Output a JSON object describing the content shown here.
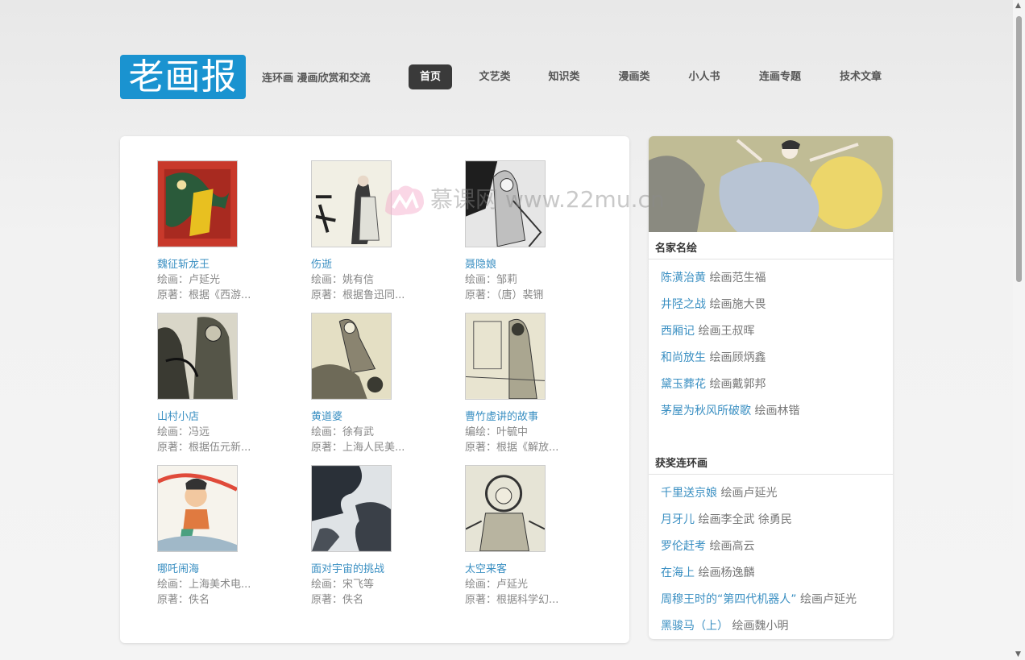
{
  "header": {
    "logo": "老画报",
    "tagline": "连环画 漫画欣赏和交流",
    "nav": [
      {
        "label": "首页",
        "active": true
      },
      {
        "label": "文艺类"
      },
      {
        "label": "知识类"
      },
      {
        "label": "漫画类"
      },
      {
        "label": "小人书"
      },
      {
        "label": "连画专题"
      },
      {
        "label": "技术文章"
      }
    ]
  },
  "books": [
    {
      "title": "魏征斩龙王",
      "line1": "绘画：卢延光",
      "line2": "原著：根据《西游..."
    },
    {
      "title": "伤逝",
      "line1": "绘画：姚有信",
      "line2": "原著：根据鲁迅同..."
    },
    {
      "title": "聂隐娘",
      "line1": "绘画：邹莉",
      "line2": "原著：（唐）裴铏"
    },
    {
      "title": "山村小店",
      "line1": "绘画：冯远",
      "line2": "原著：根据伍元新..."
    },
    {
      "title": "黄道婆",
      "line1": "绘画：徐有武",
      "line2": "原著：上海人民美..."
    },
    {
      "title": "曹竹虚讲的故事",
      "line1": "编绘：叶毓中",
      "line2": "原著：根据《解放..."
    },
    {
      "title": "哪吒闹海",
      "line1": "绘画：上海美术电...",
      "line2": "原著：佚名"
    },
    {
      "title": "面对宇宙的挑战",
      "line1": "绘画：宋飞等",
      "line2": "原著：佚名"
    },
    {
      "title": "太空来客",
      "line1": "绘画：卢延光",
      "line2": "原著：根据科学幻..."
    }
  ],
  "sidebar": {
    "section1": {
      "title": "名家名绘",
      "items": [
        {
          "link": "陈潢治黄",
          "note": "绘画范生福"
        },
        {
          "link": "井陉之战",
          "note": "绘画施大畏"
        },
        {
          "link": "西厢记",
          "note": "绘画王叔晖"
        },
        {
          "link": "和尚放生",
          "note": "绘画顾炳鑫"
        },
        {
          "link": "黛玉葬花",
          "note": "绘画戴郭邦"
        },
        {
          "link": "茅屋为秋风所破歌",
          "note": "绘画林锴"
        }
      ]
    },
    "section2": {
      "title": "获奖连环画",
      "items": [
        {
          "link": "千里送京娘",
          "note": "绘画卢延光"
        },
        {
          "link": "月牙儿",
          "note": "绘画李全武 徐勇民"
        },
        {
          "link": "罗伦赶考",
          "note": "绘画高云"
        },
        {
          "link": "在海上",
          "note": "绘画杨逸麟"
        },
        {
          "link": "周穆王时的“第四代机器人”",
          "note": "绘画卢延光"
        },
        {
          "link": "黑骏马（上）",
          "note": "绘画魏小明"
        }
      ]
    }
  },
  "watermark": "慕课网 www.22mu.cn",
  "colors": {
    "accent": "#1a93d0",
    "link": "#3a8fc2",
    "nav_active": "#3a3a3a"
  }
}
